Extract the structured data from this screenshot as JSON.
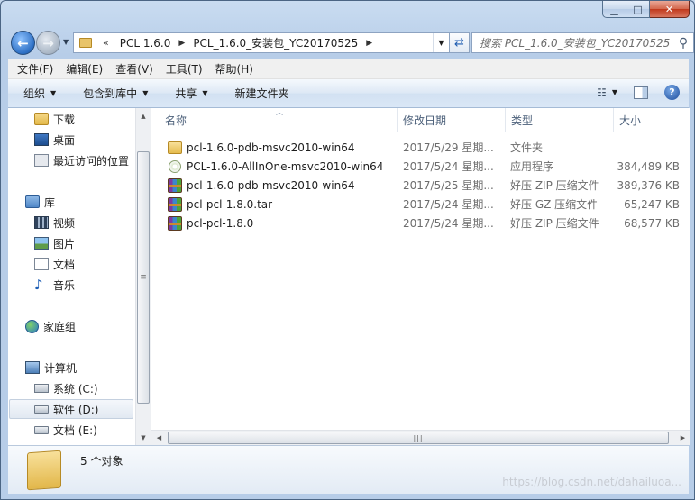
{
  "window": {
    "caption_min": "▁",
    "caption_max": "□",
    "caption_close": "✕"
  },
  "address_bar": {
    "overflow_chevron": "«",
    "crumbs": [
      "PCL 1.6.0",
      "PCL_1.6.0_安装包_YC20170525"
    ],
    "search_placeholder": "搜索 PCL_1.6.0_安装包_YC20170525"
  },
  "menubar": {
    "items": [
      "文件(F)",
      "编辑(E)",
      "查看(V)",
      "工具(T)",
      "帮助(H)"
    ]
  },
  "commandbar": {
    "organize": "组织",
    "include_library": "包含到库中",
    "share": "共享",
    "new_folder": "新建文件夹"
  },
  "navpane": {
    "items": [
      {
        "label": "下载",
        "icon": "downloads-folder-icon"
      },
      {
        "label": "桌面",
        "icon": "desktop-icon"
      },
      {
        "label": "最近访问的位置",
        "icon": "recent-places-icon"
      },
      {
        "label": "库",
        "icon": "libraries-icon"
      },
      {
        "label": "视频",
        "icon": "videos-icon"
      },
      {
        "label": "图片",
        "icon": "pictures-icon"
      },
      {
        "label": "文档",
        "icon": "documents-icon"
      },
      {
        "label": "音乐",
        "icon": "music-icon"
      },
      {
        "label": "家庭组",
        "icon": "homegroup-icon"
      },
      {
        "label": "计算机",
        "icon": "computer-icon"
      },
      {
        "label": "系统 (C:)",
        "icon": "system-drive-icon"
      },
      {
        "label": "软件 (D:)",
        "icon": "drive-icon"
      },
      {
        "label": "文档 (E:)",
        "icon": "drive-icon"
      }
    ],
    "selected": "软件 (D:)"
  },
  "filelist": {
    "columns": [
      "名称",
      "修改日期",
      "类型",
      "大小"
    ],
    "rows": [
      {
        "name": "pcl-1.6.0-pdb-msvc2010-win64",
        "date": "2017/5/29 星期...",
        "type": "文件夹",
        "size": "",
        "icon": "folder-icon"
      },
      {
        "name": "PCL-1.6.0-AllInOne-msvc2010-win64",
        "date": "2017/5/24 星期...",
        "type": "应用程序",
        "size": "384,489 KB",
        "icon": "installer-icon"
      },
      {
        "name": "pcl-1.6.0-pdb-msvc2010-win64",
        "date": "2017/5/25 星期...",
        "type": "好压 ZIP 压缩文件",
        "size": "389,376 KB",
        "icon": "archive-icon"
      },
      {
        "name": "pcl-pcl-1.8.0.tar",
        "date": "2017/5/24 星期...",
        "type": "好压 GZ 压缩文件",
        "size": "65,247 KB",
        "icon": "archive-icon"
      },
      {
        "name": "pcl-pcl-1.8.0",
        "date": "2017/5/24 星期...",
        "type": "好压 ZIP 压缩文件",
        "size": "68,577 KB",
        "icon": "archive-icon"
      }
    ]
  },
  "details": {
    "count_text": "5 个对象"
  },
  "watermark": "https://blog.csdn.net/dahailuoa..."
}
